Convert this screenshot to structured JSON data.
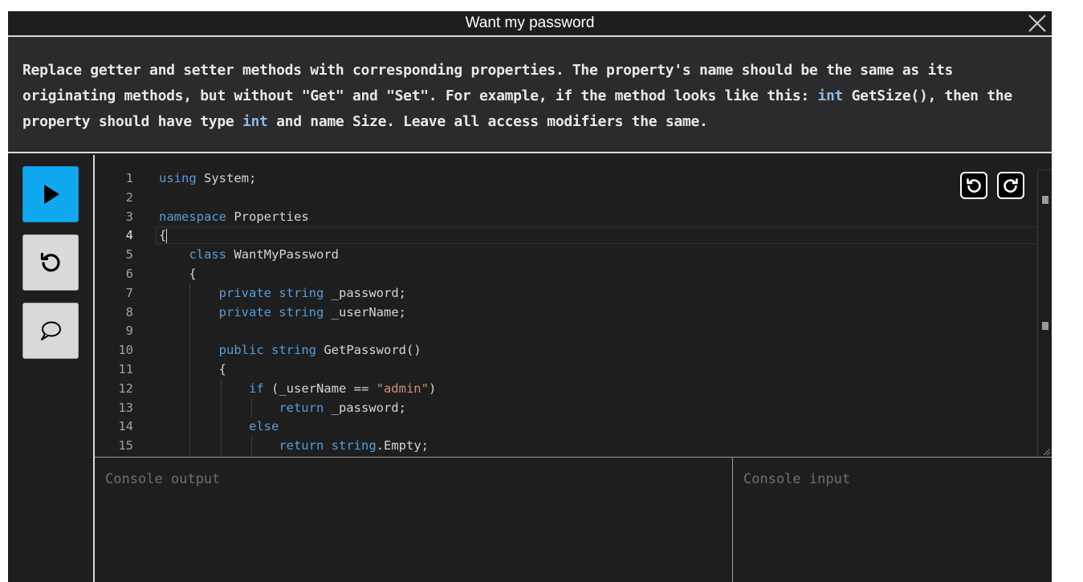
{
  "window": {
    "title": "Want my password"
  },
  "description": {
    "part1": "Replace getter and setter methods with corresponding properties. The property's name should be the same as its originating methods, but without \"Get\" and \"Set\". For example, if the method looks like this: ",
    "code1": "int",
    "part2": " GetSize(), then the property should have type ",
    "code2": "int",
    "part3": " and name Size. Leave all access modifiers the same."
  },
  "sidebar": {
    "run_icon": "play-icon",
    "reset_icon": "reset-icon",
    "chat_icon": "chat-bubble-icon"
  },
  "editor": {
    "undo_icon": "undo-icon",
    "redo_icon": "redo-icon",
    "active_line": 4,
    "lines": [
      {
        "num": "1",
        "tokens": [
          {
            "t": "using",
            "c": "k"
          },
          {
            "t": " System;",
            "c": ""
          }
        ]
      },
      {
        "num": "2",
        "tokens": []
      },
      {
        "num": "3",
        "tokens": [
          {
            "t": "namespace",
            "c": "k"
          },
          {
            "t": " Properties",
            "c": ""
          }
        ]
      },
      {
        "num": "4",
        "tokens": [
          {
            "t": "{",
            "c": ""
          }
        ]
      },
      {
        "num": "5",
        "tokens": [
          {
            "t": "    ",
            "c": ""
          },
          {
            "t": "class",
            "c": "k"
          },
          {
            "t": " WantMyPassword",
            "c": ""
          }
        ]
      },
      {
        "num": "6",
        "tokens": [
          {
            "t": "    {",
            "c": ""
          }
        ]
      },
      {
        "num": "7",
        "tokens": [
          {
            "t": "        ",
            "c": ""
          },
          {
            "t": "private",
            "c": "k"
          },
          {
            "t": " ",
            "c": ""
          },
          {
            "t": "string",
            "c": "k"
          },
          {
            "t": " _password;",
            "c": ""
          }
        ]
      },
      {
        "num": "8",
        "tokens": [
          {
            "t": "        ",
            "c": ""
          },
          {
            "t": "private",
            "c": "k"
          },
          {
            "t": " ",
            "c": ""
          },
          {
            "t": "string",
            "c": "k"
          },
          {
            "t": " _userName;",
            "c": ""
          }
        ]
      },
      {
        "num": "9",
        "tokens": []
      },
      {
        "num": "10",
        "tokens": [
          {
            "t": "        ",
            "c": ""
          },
          {
            "t": "public",
            "c": "k"
          },
          {
            "t": " ",
            "c": ""
          },
          {
            "t": "string",
            "c": "k"
          },
          {
            "t": " GetPassword()",
            "c": ""
          }
        ]
      },
      {
        "num": "11",
        "tokens": [
          {
            "t": "        {",
            "c": ""
          }
        ]
      },
      {
        "num": "12",
        "tokens": [
          {
            "t": "            ",
            "c": ""
          },
          {
            "t": "if",
            "c": "k"
          },
          {
            "t": " (_userName == ",
            "c": ""
          },
          {
            "t": "\"admin\"",
            "c": "s"
          },
          {
            "t": ")",
            "c": ""
          }
        ]
      },
      {
        "num": "13",
        "tokens": [
          {
            "t": "                ",
            "c": ""
          },
          {
            "t": "return",
            "c": "k"
          },
          {
            "t": " _password;",
            "c": ""
          }
        ]
      },
      {
        "num": "14",
        "tokens": [
          {
            "t": "            ",
            "c": ""
          },
          {
            "t": "else",
            "c": "k"
          }
        ]
      },
      {
        "num": "15",
        "tokens": [
          {
            "t": "                ",
            "c": ""
          },
          {
            "t": "return",
            "c": "k"
          },
          {
            "t": " ",
            "c": ""
          },
          {
            "t": "string",
            "c": "k"
          },
          {
            "t": ".Empty;",
            "c": ""
          }
        ]
      }
    ]
  },
  "console": {
    "output_placeholder": "Console output",
    "input_placeholder": "Console input"
  }
}
